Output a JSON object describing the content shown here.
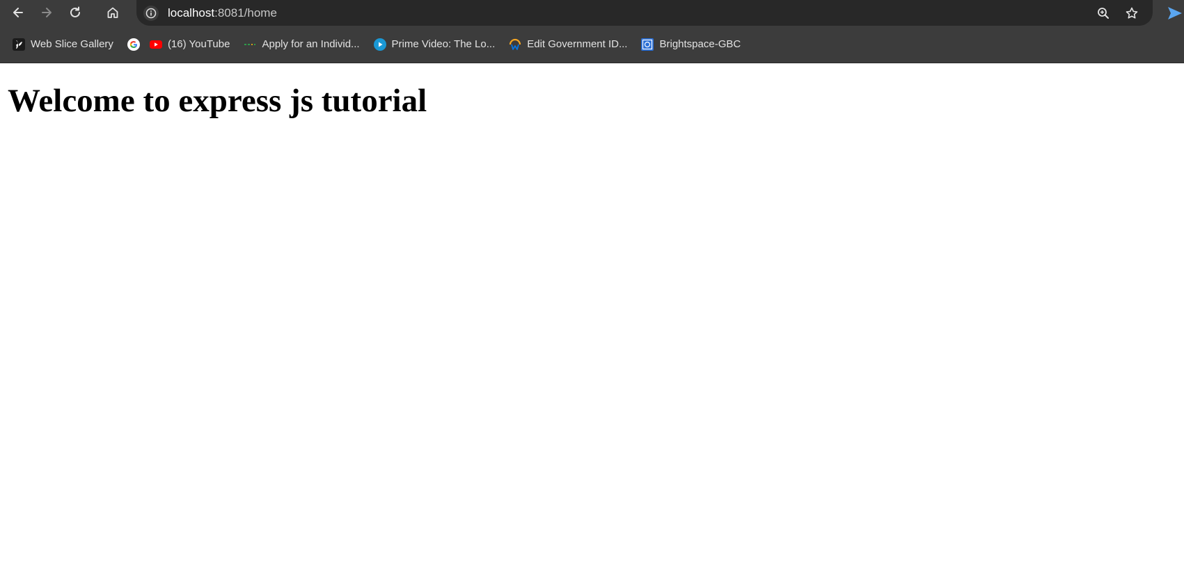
{
  "browser": {
    "url_host": "localhost",
    "url_rest": ":8081/home",
    "nav": {
      "back_icon": "arrow-left-icon",
      "forward_icon": "arrow-right-icon",
      "reload_icon": "reload-icon",
      "home_icon": "home-icon"
    },
    "omnibox_actions": [
      "zoom-icon",
      "star-icon"
    ],
    "extension_icon": "send-arrow-icon",
    "colors": {
      "chrome_bg": "#3c3c3c",
      "omnibox_bg": "#282828",
      "text": "#e3e3e3",
      "accent": "#5aa6f0"
    }
  },
  "bookmarks": [
    {
      "label": "Web Slice Gallery",
      "icon": "web-slice-icon"
    },
    {
      "label": "",
      "icon": "google-icon"
    },
    {
      "label": "(16) YouTube",
      "icon": "youtube-icon"
    },
    {
      "label": "Apply for an Individ...",
      "icon": "dots-icon"
    },
    {
      "label": "Prime Video: The Lo...",
      "icon": "prime-video-icon"
    },
    {
      "label": "Edit Government ID...",
      "icon": "workday-icon"
    },
    {
      "label": "Brightspace-GBC",
      "icon": "brightspace-icon"
    }
  ],
  "page": {
    "heading": "Welcome to express js tutorial"
  }
}
